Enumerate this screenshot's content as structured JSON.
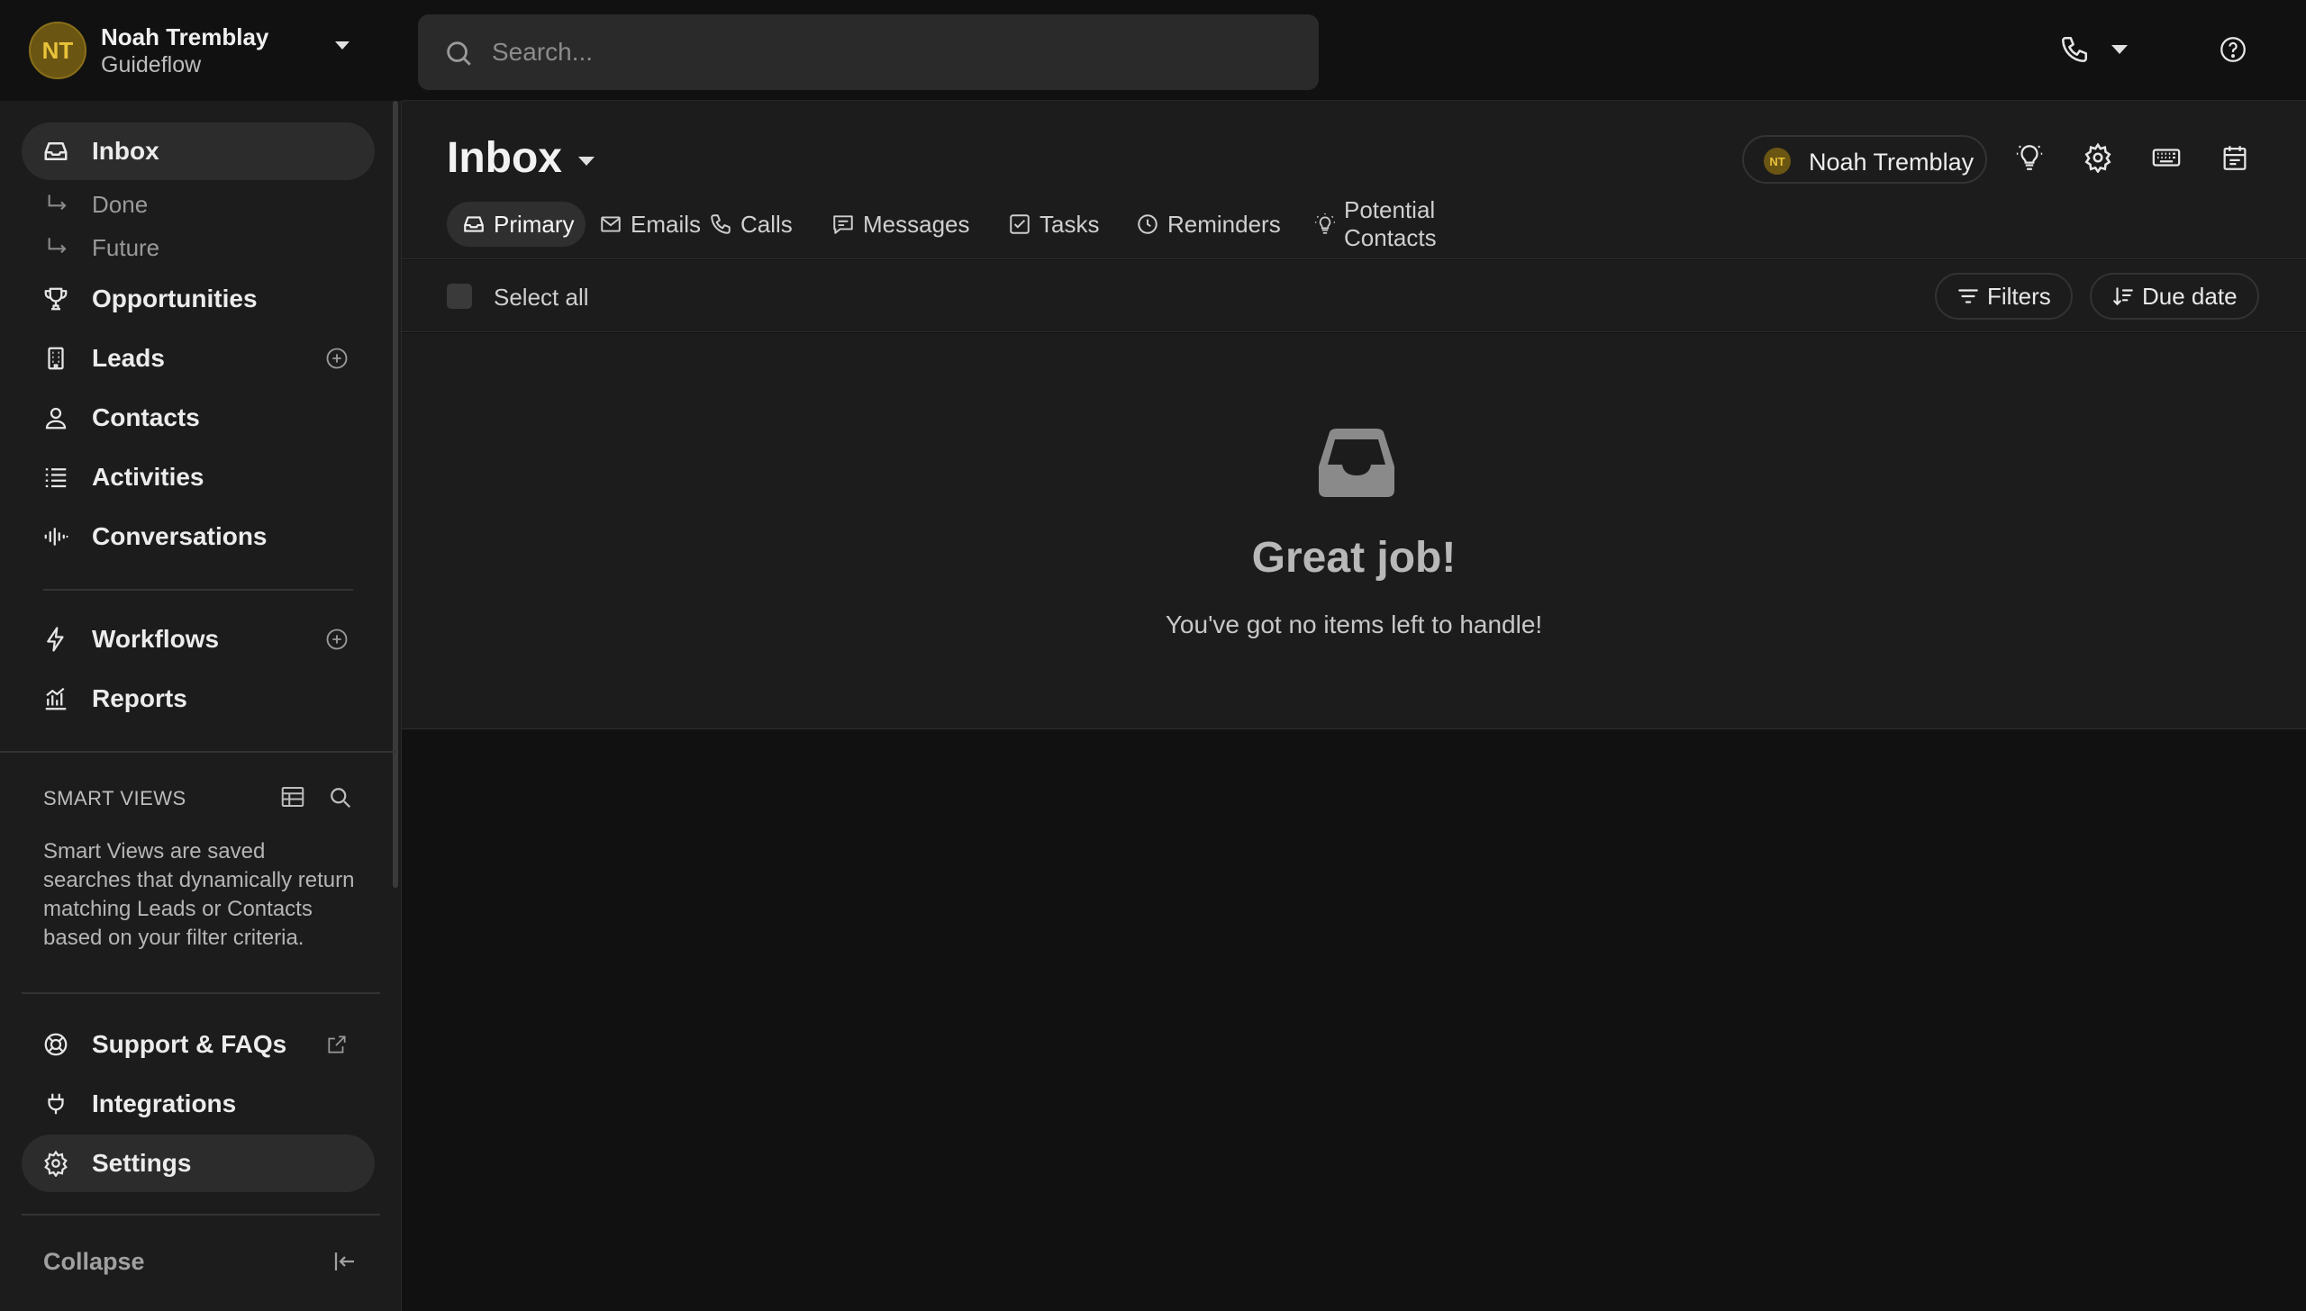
{
  "account": {
    "initials": "NT",
    "user_name": "Noah Tremblay",
    "org_name": "Guideflow"
  },
  "search": {
    "placeholder": "Search..."
  },
  "sidebar": {
    "inbox_label": "Inbox",
    "done_label": "Done",
    "future_label": "Future",
    "opportunities_label": "Opportunities",
    "leads_label": "Leads",
    "contacts_label": "Contacts",
    "activities_label": "Activities",
    "conversations_label": "Conversations",
    "workflows_label": "Workflows",
    "reports_label": "Reports",
    "smart_views_title": "SMART VIEWS",
    "smart_views_description": "Smart Views are saved searches that dynamically return matching Leads or Contacts based on your filter criteria.",
    "support_label": "Support & FAQs",
    "integrations_label": "Integrations",
    "settings_label": "Settings",
    "collapse_label": "Collapse"
  },
  "header": {
    "title": "Inbox",
    "owner_initials": "NT",
    "owner_name": "Noah Tremblay"
  },
  "tabs": [
    {
      "label": "Primary",
      "icon": "inbox-icon",
      "active": true
    },
    {
      "label": "Emails",
      "icon": "mail-icon",
      "active": false
    },
    {
      "label": "Calls",
      "icon": "phone-icon",
      "active": false
    },
    {
      "label": "Messages",
      "icon": "message-icon",
      "active": false
    },
    {
      "label": "Tasks",
      "icon": "checkbox-icon",
      "active": false
    },
    {
      "label": "Reminders",
      "icon": "clock-icon",
      "active": false
    },
    {
      "label": "Potential Contacts",
      "icon": "lightbulb-icon",
      "active": false
    }
  ],
  "toolbar": {
    "select_all_label": "Select all",
    "filters_label": "Filters",
    "sort_label": "Due date"
  },
  "empty_state": {
    "title": "Great job!",
    "subtitle": "You've got no items left to handle!"
  },
  "colors": {
    "background": "#111111",
    "panel": "#1c1c1c",
    "avatar_bg": "#6b5512",
    "avatar_text": "#e8c23a"
  }
}
